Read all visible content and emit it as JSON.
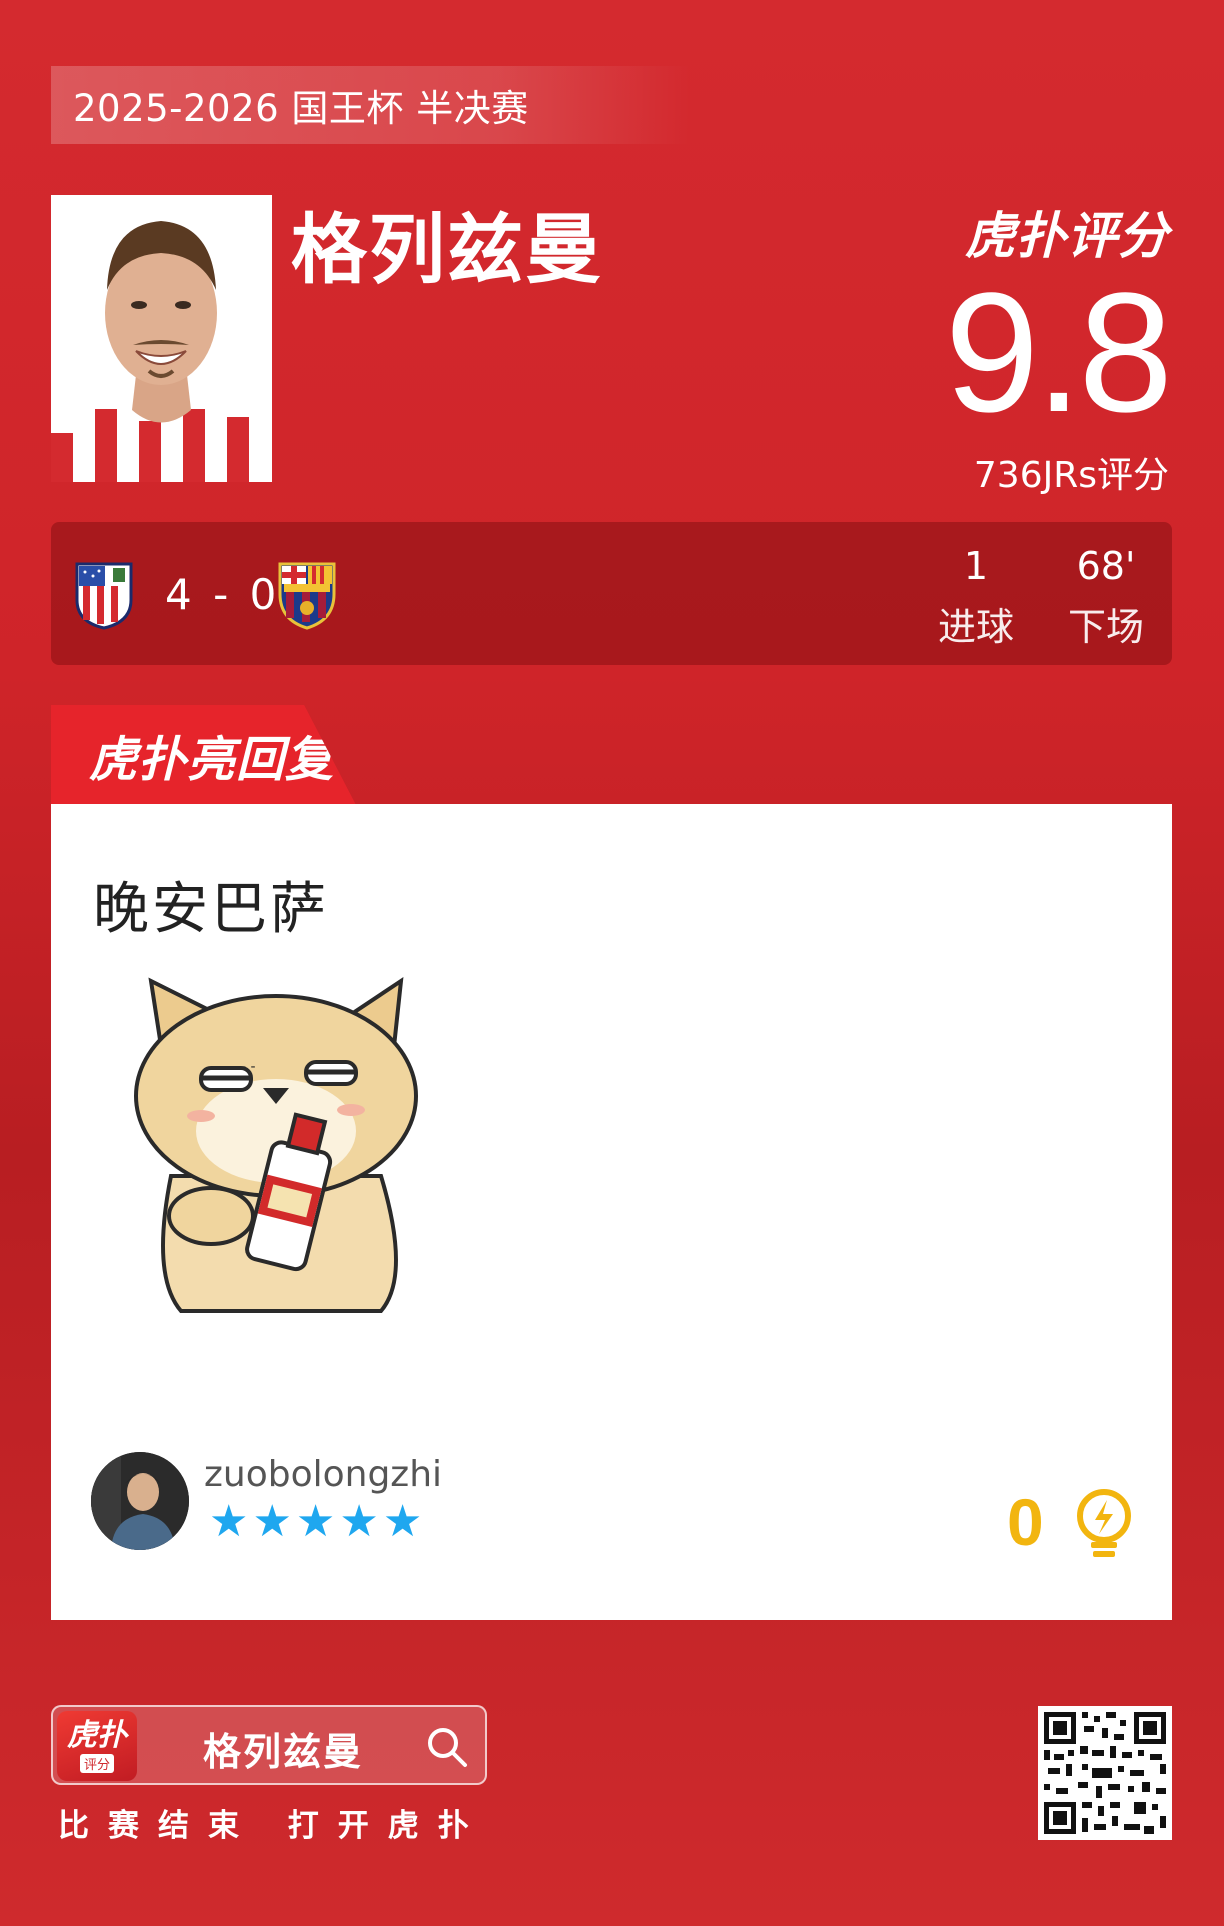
{
  "competition": "2025-2026 国王杯 半决赛",
  "player": {
    "name": "格列兹曼"
  },
  "rating": {
    "brand": "虎扑评分",
    "score": "9.8",
    "votes_label": "736JRs评分"
  },
  "match": {
    "score": "4 - 0",
    "home_crest": "atletico-madrid-crest",
    "away_crest": "fc-barcelona-crest",
    "stats": [
      {
        "value": "1",
        "label": "进球"
      },
      {
        "value": "68'",
        "label": "下场"
      }
    ]
  },
  "highlight": {
    "tab_label": "虎扑亮回复",
    "comment": "晚安巴萨",
    "sticker": "dog-drinking-bottle-sticker",
    "username": "zuobolongzhi",
    "stars": 5,
    "like_count": "0"
  },
  "footer": {
    "app_icon_big": "虎扑",
    "app_icon_small": "评分",
    "search_text": "格列兹曼",
    "hint": "比赛结束 打开虎扑"
  },
  "colors": {
    "background": "#cf2429",
    "accent_tab": "#e6242b",
    "star": "#1fa7ef",
    "like": "#f2b50f"
  }
}
